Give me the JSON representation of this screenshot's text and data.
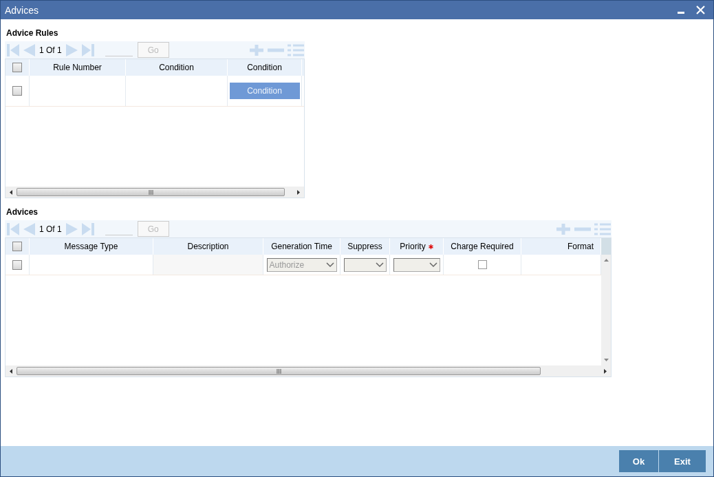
{
  "window": {
    "title": "Advices"
  },
  "advice_rules": {
    "title": "Advice Rules",
    "pager": {
      "text": "1 Of 1",
      "go": "Go"
    },
    "select_all_checked": false,
    "columns": [
      {
        "label": "Rule Number"
      },
      {
        "label": "Condition"
      },
      {
        "label": "Condition"
      }
    ],
    "rows": [
      {
        "checked": false,
        "cells": [
          {
            "kind": "text"
          },
          {
            "kind": "text"
          },
          {
            "kind": "button",
            "label": "Condition"
          }
        ]
      }
    ]
  },
  "advices": {
    "title": "Advices",
    "pager": {
      "text": "1 Of 1",
      "go": "Go"
    },
    "select_all_checked": false,
    "columns": [
      {
        "label": "Message Type",
        "required": false
      },
      {
        "label": "Description",
        "required": false
      },
      {
        "label": "Generation Time",
        "required": false
      },
      {
        "label": "Suppress",
        "required": false
      },
      {
        "label": "Priority",
        "required": true
      },
      {
        "label": "Charge Required",
        "required": false
      },
      {
        "label": "Format",
        "required": false
      }
    ],
    "rows": [
      {
        "checked": false,
        "cells": [
          {
            "kind": "text"
          },
          {
            "kind": "readonly"
          },
          {
            "kind": "select",
            "value": "Authorize"
          },
          {
            "kind": "select"
          },
          {
            "kind": "select"
          },
          {
            "kind": "checkbox",
            "checked": false
          },
          {
            "kind": "text"
          }
        ]
      }
    ]
  },
  "buttons": [
    "Ok",
    "Exit"
  ]
}
